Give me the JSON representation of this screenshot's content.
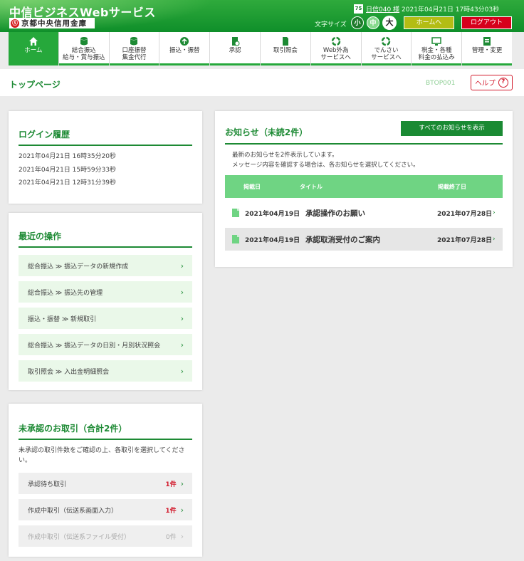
{
  "header": {
    "service_name": "中信ビジネスWebサービス",
    "bank_mark": "Ⓢ",
    "bank_name": "京都中央信用金庫",
    "user_badge": "75",
    "user_name": "日信040 様",
    "last_login": "2021年04月21日 17時43分03秒",
    "font_size_label": "文字サイズ",
    "font_small": "小",
    "font_medium": "中",
    "font_large": "大",
    "home_button": "ホームへ",
    "logout_button": "ログアウト"
  },
  "nav": [
    {
      "label": "ホーム",
      "icon": "home-icon"
    },
    {
      "label": "総合振込\n給与・賞与振込",
      "icon": "database-icon"
    },
    {
      "label": "口座振替\n集金代行",
      "icon": "database-icon"
    },
    {
      "label": "振込・振替",
      "icon": "transfer-icon"
    },
    {
      "label": "承認",
      "icon": "approval-icon"
    },
    {
      "label": "取引照会",
      "icon": "document-icon"
    },
    {
      "label": "Web外為\nサービスへ",
      "icon": "recycle-icon"
    },
    {
      "label": "でんさい\nサービスへ",
      "icon": "recycle-icon"
    },
    {
      "label": "税金・各種\n料金の払込み",
      "icon": "monitor-icon"
    },
    {
      "label": "管理・変更",
      "icon": "settings-icon"
    }
  ],
  "page": {
    "title": "トップページ",
    "id": "BTOP001",
    "help": "ヘルプ"
  },
  "login_history": {
    "title": "ログイン履歴",
    "rows": [
      "2021年04月21日 16時35分20秒",
      "2021年04月21日 15時59分33秒",
      "2021年04月21日 12時31分39秒"
    ]
  },
  "recent_ops": {
    "title": "最近の操作",
    "items": [
      "総合振込 ≫ 振込データの新規作成",
      "総合振込 ≫ 振込先の管理",
      "振込・振替 ≫ 新規取引",
      "総合振込 ≫ 振込データの日別・月別状況照会",
      "取引照会 ≫ 入出金明細照会"
    ]
  },
  "unapproved": {
    "title": "未承認のお取引（合計2件）",
    "description": "未承認の取引件数をご確認の上、各取引を選択してください。",
    "rows": [
      {
        "label": "承認待ち取引",
        "count": "1件",
        "disabled": false
      },
      {
        "label": "作成中取引（伝送系画面入力）",
        "count": "1件",
        "disabled": false
      },
      {
        "label": "作成中取引（伝送系ファイル受付）",
        "count": "0件",
        "disabled": true
      }
    ]
  },
  "news": {
    "title": "お知らせ（未読2件）",
    "show_all": "すべてのお知らせを表示",
    "description_line1": "最新のお知らせを2件表示しています。",
    "description_line2": "メッセージ内容を確認する場合は、各お知らせを選択してください。",
    "col_date": "掲載日",
    "col_title": "タイトル",
    "col_end": "掲載終了日",
    "rows": [
      {
        "date": "2021年04月19日",
        "title": "承認操作のお願い",
        "end": "2021年07月28日"
      },
      {
        "date": "2021年04月19日",
        "title": "承認取消受付のご案内",
        "end": "2021年07月28日"
      }
    ]
  },
  "colors": {
    "brand_green": "#1d8a34",
    "header_green": "#2faa3c",
    "logout_red": "#d7001c",
    "home_olive": "#b3bd14"
  }
}
